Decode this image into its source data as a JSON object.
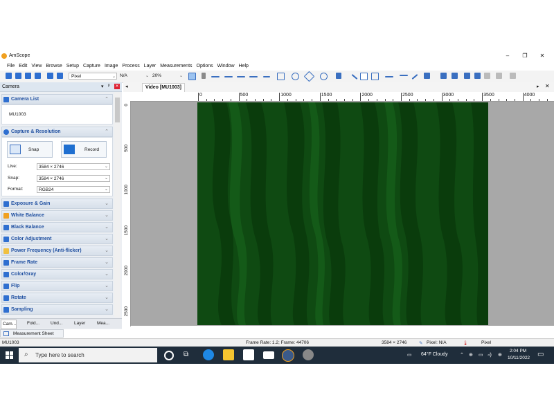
{
  "window": {
    "title": "AmScope"
  },
  "menu": [
    "File",
    "Edit",
    "View",
    "Browse",
    "Setup",
    "Capture",
    "Image",
    "Process",
    "Layer",
    "Measurements",
    "Options",
    "Window",
    "Help"
  ],
  "toolbar": {
    "unit": "Pixel",
    "measure": "N/A",
    "zoom": "20%"
  },
  "left_panel": {
    "title": "Camera",
    "camera_list": {
      "title": "Camera List",
      "device": "MU1003"
    },
    "capture": {
      "title": "Capture & Resolution",
      "snap_label": "Snap",
      "record_label": "Record",
      "live_label": "Live:",
      "live_value": "3584 × 2746",
      "snap_res_label": "Snap:",
      "snap_res_value": "3584 × 2746",
      "format_label": "Format:",
      "format_value": "RGB24"
    },
    "sections": [
      "Exposure & Gain",
      "White Balance",
      "Black Balance",
      "Color Adjustment",
      "Power Frequency (Anti-flicker)",
      "Frame Rate",
      "Color/Gray",
      "Flip",
      "Rotate",
      "Sampling"
    ],
    "section_colors": [
      "#2f6fd0",
      "#f0a020",
      "#2f6fd0",
      "#2f6fd0",
      "#f0c040",
      "#2f6fd0",
      "#2f6fd0",
      "#2f6fd0",
      "#2f6fd0",
      "#2f6fd0"
    ],
    "bottom_tabs": [
      "Cam...",
      "Fold...",
      "Und...",
      "Layer",
      "Mea..."
    ]
  },
  "document": {
    "tab_title": "Video [MU1003]",
    "h_ruler": [
      "0",
      "500",
      "1000",
      "1500",
      "2000",
      "2500",
      "3000",
      "3500",
      "4000"
    ],
    "v_ruler": [
      "0",
      "500",
      "1000",
      "1500",
      "2000",
      "2500"
    ]
  },
  "measurement_sheet": {
    "label": "Measurement Sheet"
  },
  "status": {
    "camera": "MU1003",
    "frame_info": "Frame Rate: 1.2; Frame: 44706",
    "resolution": "3584 × 2746",
    "pixel_info": "Pixel: N/A",
    "unit": "Pixel"
  },
  "taskbar": {
    "search_placeholder": "Type here to search",
    "weather": "64°F  Cloudy",
    "time": "2:04 PM",
    "date": "10/11/2022"
  }
}
